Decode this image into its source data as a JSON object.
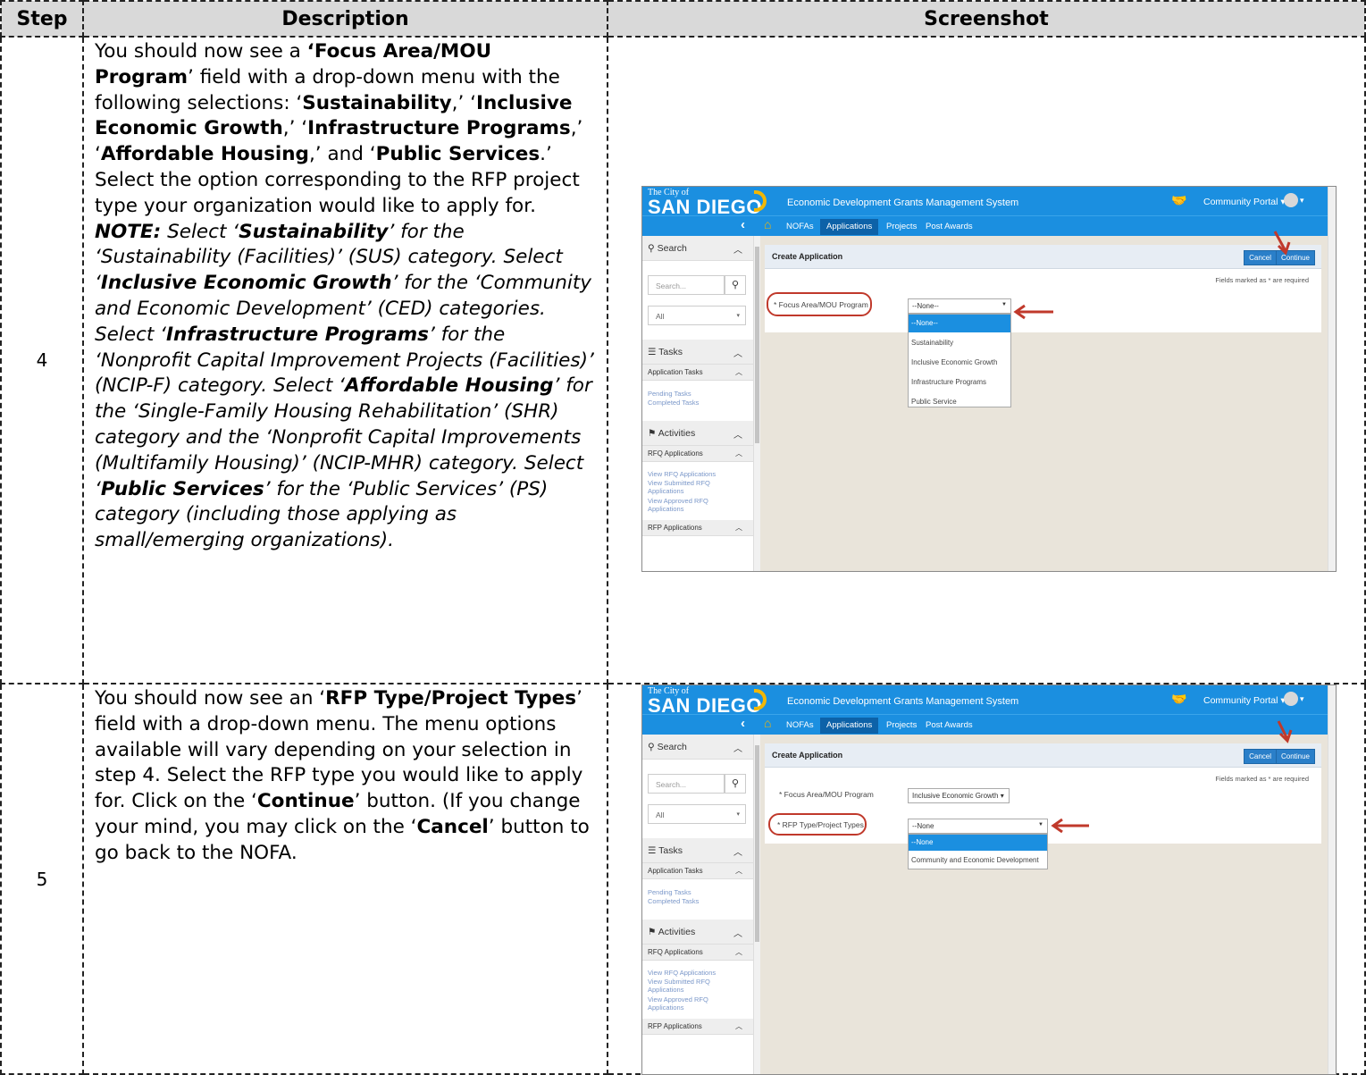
{
  "table": {
    "headers": {
      "step": "Step",
      "description": "Description",
      "screenshot": "Screenshot"
    }
  },
  "step4": {
    "number": "4"
  },
  "step5": {
    "number": "5"
  },
  "texts": {
    "s4": {
      "a1": "You should now see a ",
      "b1": "‘Focus Area/MOU Program",
      "a2": "’ field with a drop-down menu with the following selections: ‘",
      "b2": "Sustainability",
      "a3": ",’ ‘",
      "b3": "Inclusive Economic Growth",
      "a4": ",’ ‘",
      "b4": "Infrastructure Programs",
      "a5": ",’ ‘",
      "b5": "Affordable Housing",
      "a6": ",’ and ‘",
      "b6": "Public Services",
      "a7": ".’ Select the option corresponding to the RFP project type your organization would like to apply for. ",
      "n1": "NOTE:",
      "i1": " Select ‘",
      "n2": "Sustainability",
      "i2": "’ for the ‘Sustainability (Facilities)’ (SUS) category. Select ‘",
      "n3": "Inclusive Economic Growth",
      "i3": "’ for the ‘Community and Economic Development’ (CED) categories. Select ‘",
      "n4": "Infrastructure Programs",
      "i4": "’ for the ‘Nonprofit Capital Improvement Projects (Facilities)’ (NCIP-F) category. Select ‘",
      "n5": "Affordable Housing",
      "i5": "’ for the ‘Single-Family Housing Rehabilitation’ (SHR) category and the ‘Nonprofit Capital Improvements (Multifamily Housing)’ (NCIP-MHR) category. Select ‘",
      "n6": "Public Services",
      "i6": "’ for the ‘Public Services’ (PS) category (including those applying as small/emerging organizations)."
    },
    "s5": {
      "a1": "You should now see an ‘",
      "b1": "RFP Type/Project Types",
      "a2": "’ field with a drop-down menu. The menu options available will vary depending on your selection in step 4. Select the RFP type you would like to apply for. Click on the ‘",
      "b2": "Continue",
      "a3": "’ button. (If you change your mind, you may click on the ‘",
      "b3": "Cancel",
      "a4": "’ button to go back to the NOFA."
    }
  },
  "app": {
    "logo_small": "The City of",
    "logo_big": "SAN DIEGO",
    "system_title": "Economic Development Grants Management System",
    "portal": "Community Portal ▾",
    "user_caret": "▾",
    "nav": [
      "NOFAs",
      "Applications",
      "Projects",
      "Post Awards"
    ],
    "sidebar": {
      "search_title": "Search",
      "search_placeholder": "Search...",
      "filter_value": "All",
      "tasks_title": "Tasks",
      "app_tasks": "Application Tasks",
      "pending": "Pending Tasks",
      "completed": "Completed Tasks",
      "activities_title": "Activities",
      "rfq_apps": "RFQ Applications",
      "view_rfq": "View RFQ Applications",
      "view_submitted": "View Submitted RFQ Applications",
      "view_approved": "View Approved RFQ Applications",
      "rfp_apps": "RFP Applications"
    },
    "panel_title": "Create Application",
    "cancel": "Cancel",
    "continue": "Continue",
    "required_note": "Fields marked as * are required",
    "focus_label": "* Focus Area/MOU Program",
    "rfp_label": "* RFP Type/Project Types",
    "shot1": {
      "select_value": "--None--",
      "options": [
        "--None--",
        "Sustainability",
        "Inclusive Economic Growth",
        "Infrastructure Programs",
        "Public Service"
      ]
    },
    "shot2": {
      "focus_value": "Inclusive Economic Growth ▾",
      "select_value": "--None",
      "options": [
        "--None",
        "Community and Economic Development"
      ]
    }
  },
  "colors": {
    "header_bg": "#d9d9d9",
    "app_blue": "#1b8fe0",
    "annotation_red": "#c0392b",
    "logo_yellow": "#f2b705"
  }
}
